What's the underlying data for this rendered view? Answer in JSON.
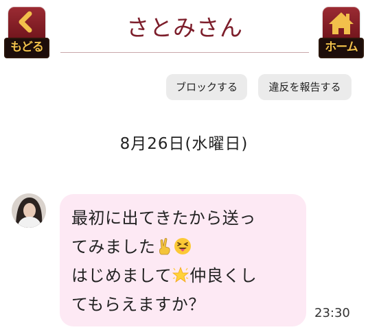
{
  "header": {
    "title": "さとみさん",
    "back_label": "もどる",
    "home_label": "ホーム"
  },
  "actions": {
    "block_label": "ブロックする",
    "report_label": "違反を報告する"
  },
  "conversation": {
    "date_label": "8月26日(水曜日)",
    "message": {
      "lines": [
        {
          "text": "最初に出てきたから送っ",
          "emoji": ""
        },
        {
          "text": "てみました",
          "emoji": "victory-hand-and-squinting-tongue-emoji"
        },
        {
          "text_before": "はじめまして",
          "emoji": "glowing-star-emoji",
          "text_after": "仲良くし"
        },
        {
          "text": "てもらえますか？",
          "emoji": ""
        }
      ],
      "time": "23:30"
    }
  },
  "colors": {
    "accent": "#7c1d2a",
    "bubble": "#fde9f4",
    "pill": "#ebebeb",
    "badge_text": "#f2c04b"
  }
}
